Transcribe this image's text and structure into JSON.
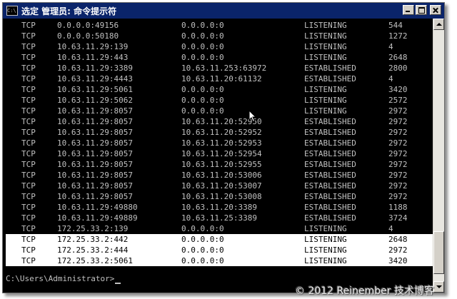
{
  "window": {
    "title": "选定 管理员: 命令提示符",
    "icon_text": "C:\\."
  },
  "netstat_rows": [
    {
      "proto": "TCP",
      "local": "0.0.0.0:49156",
      "foreign": "0.0.0.0:0",
      "state": "LISTENING",
      "pid": "544"
    },
    {
      "proto": "TCP",
      "local": "0.0.0.0:50180",
      "foreign": "0.0.0.0:0",
      "state": "LISTENING",
      "pid": "1272"
    },
    {
      "proto": "TCP",
      "local": "10.63.11.29:139",
      "foreign": "0.0.0.0:0",
      "state": "LISTENING",
      "pid": "4"
    },
    {
      "proto": "TCP",
      "local": "10.63.11.29:443",
      "foreign": "0.0.0.0:0",
      "state": "LISTENING",
      "pid": "2648"
    },
    {
      "proto": "TCP",
      "local": "10.63.11.29:3389",
      "foreign": "10.63.11.253:63972",
      "state": "ESTABLISHED",
      "pid": "2800"
    },
    {
      "proto": "TCP",
      "local": "10.63.11.29:4443",
      "foreign": "10.63.11.20:61132",
      "state": "ESTABLISHED",
      "pid": "4"
    },
    {
      "proto": "TCP",
      "local": "10.63.11.29:5061",
      "foreign": "0.0.0.0:0",
      "state": "LISTENING",
      "pid": "3420"
    },
    {
      "proto": "TCP",
      "local": "10.63.11.29:5062",
      "foreign": "0.0.0.0:0",
      "state": "LISTENING",
      "pid": "2572"
    },
    {
      "proto": "TCP",
      "local": "10.63.11.29:8057",
      "foreign": "0.0.0.0:0",
      "state": "LISTENING",
      "pid": "2972"
    },
    {
      "proto": "TCP",
      "local": "10.63.11.29:8057",
      "foreign": "10.63.11.20:52950",
      "state": "ESTABLISHED",
      "pid": "2972"
    },
    {
      "proto": "TCP",
      "local": "10.63.11.29:8057",
      "foreign": "10.63.11.20:52952",
      "state": "ESTABLISHED",
      "pid": "2972"
    },
    {
      "proto": "TCP",
      "local": "10.63.11.29:8057",
      "foreign": "10.63.11.20:52953",
      "state": "ESTABLISHED",
      "pid": "2972"
    },
    {
      "proto": "TCP",
      "local": "10.63.11.29:8057",
      "foreign": "10.63.11.20:52954",
      "state": "ESTABLISHED",
      "pid": "2972"
    },
    {
      "proto": "TCP",
      "local": "10.63.11.29:8057",
      "foreign": "10.63.11.20:52955",
      "state": "ESTABLISHED",
      "pid": "2972"
    },
    {
      "proto": "TCP",
      "local": "10.63.11.29:8057",
      "foreign": "10.63.11.20:53006",
      "state": "ESTABLISHED",
      "pid": "2972"
    },
    {
      "proto": "TCP",
      "local": "10.63.11.29:8057",
      "foreign": "10.63.11.20:53007",
      "state": "ESTABLISHED",
      "pid": "2972"
    },
    {
      "proto": "TCP",
      "local": "10.63.11.29:8057",
      "foreign": "10.63.11.20:53008",
      "state": "ESTABLISHED",
      "pid": "2972"
    },
    {
      "proto": "TCP",
      "local": "10.63.11.29:49880",
      "foreign": "10.63.11.20:3389",
      "state": "ESTABLISHED",
      "pid": "1188"
    },
    {
      "proto": "TCP",
      "local": "10.63.11.29:49889",
      "foreign": "10.63.11.25:3389",
      "state": "ESTABLISHED",
      "pid": "3724"
    },
    {
      "proto": "TCP",
      "local": "172.25.33.2:139",
      "foreign": "0.0.0.0:0",
      "state": "LISTENING",
      "pid": "4"
    },
    {
      "proto": "TCP",
      "local": "172.25.33.2:442",
      "foreign": "0.0.0.0:0",
      "state": "LISTENING",
      "pid": "2648",
      "selected": true
    },
    {
      "proto": "TCP",
      "local": "172.25.33.2:444",
      "foreign": "0.0.0.0:0",
      "state": "LISTENING",
      "pid": "2972",
      "selected": true
    },
    {
      "proto": "TCP",
      "local": "172.25.33.2:5061",
      "foreign": "0.0.0.0:0",
      "state": "LISTENING",
      "pid": "3420",
      "selected": true
    }
  ],
  "prompt": "C:\\Users\\Administrator>",
  "watermark": "© 2012 Reinember 技术博客",
  "colors": {
    "console_bg": "#000000",
    "console_fg": "#c0c0c0",
    "selection_bg": "#ffffff",
    "titlebar": "#0a246a"
  }
}
